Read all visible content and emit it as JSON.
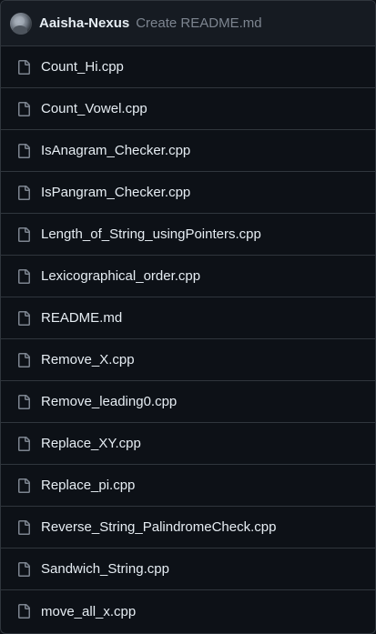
{
  "commit": {
    "author": "Aaisha-Nexus",
    "message": "Create README.md",
    "avatar_icon": "user-avatar"
  },
  "file_icon": "file-icon",
  "colors": {
    "background": "#0d1117",
    "header_background": "#161b22",
    "border": "#30363d",
    "text": "#e6edf3",
    "muted_text": "#7d8590",
    "icon": "#7d8590"
  },
  "files": [
    {
      "name": "Count_Hi.cpp"
    },
    {
      "name": "Count_Vowel.cpp"
    },
    {
      "name": "IsAnagram_Checker.cpp"
    },
    {
      "name": "IsPangram_Checker.cpp"
    },
    {
      "name": "Length_of_String_usingPointers.cpp"
    },
    {
      "name": "Lexicographical_order.cpp"
    },
    {
      "name": "README.md"
    },
    {
      "name": "Remove_X.cpp"
    },
    {
      "name": "Remove_leading0.cpp"
    },
    {
      "name": "Replace_XY.cpp"
    },
    {
      "name": "Replace_pi.cpp"
    },
    {
      "name": "Reverse_String_PalindromeCheck.cpp"
    },
    {
      "name": "Sandwich_String.cpp"
    },
    {
      "name": "move_all_x.cpp"
    }
  ]
}
